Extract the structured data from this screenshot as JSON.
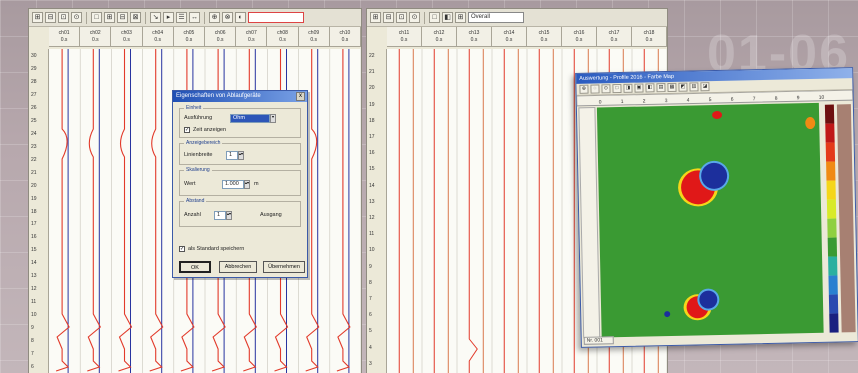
{
  "background": {
    "watermark": "01-06"
  },
  "left_window": {
    "toolbar": {
      "buttons": [
        "⊞",
        "⊟",
        "⊡",
        "⊙",
        "□",
        "⊞",
        "⊟",
        "⊠",
        "↘",
        "▸",
        "☰",
        "↔",
        "⊕",
        "⊗",
        "◐"
      ],
      "red_input": ""
    },
    "channels": [
      {
        "top": "ch01",
        "bottom": "0.s"
      },
      {
        "top": "ch02",
        "bottom": "0.s"
      },
      {
        "top": "ch03",
        "bottom": "0.s"
      },
      {
        "top": "ch04",
        "bottom": "0.s"
      },
      {
        "top": "ch05",
        "bottom": "0.s"
      },
      {
        "top": "ch06",
        "bottom": "0.s"
      },
      {
        "top": "ch07",
        "bottom": "0.s"
      },
      {
        "top": "ch08",
        "bottom": "0.s"
      },
      {
        "top": "ch09",
        "bottom": "0.s"
      },
      {
        "top": "ch10",
        "bottom": "0.s"
      }
    ],
    "axis_ticks": [
      "30",
      "29",
      "28",
      "27",
      "26",
      "25",
      "24",
      "23",
      "22",
      "21",
      "20",
      "19",
      "18",
      "17",
      "16",
      "15",
      "14",
      "13",
      "12",
      "11",
      "10",
      "9",
      "8",
      "7",
      "6"
    ]
  },
  "dialog": {
    "title": "Eigenschaften von Ablaufgeräte",
    "close": "x",
    "group1": {
      "label": "Einheit",
      "row_label": "Ausführung",
      "select_value": "Ohm",
      "checkbox_label": "Zeit anzeigen",
      "checked": true
    },
    "group2": {
      "label": "Anzeigebereich",
      "row_label": "Linienbreite",
      "value": "1"
    },
    "group3": {
      "label": "Skalierung",
      "row_label": "Wert",
      "value": "1.000",
      "unit": "m"
    },
    "group4": {
      "label": "Abstand",
      "row_label": "Anzahl",
      "value": "1",
      "extra": "Ausgang"
    },
    "bottom_checkbox": {
      "label": "als Standard speichern",
      "checked": true
    },
    "buttons": {
      "ok": "OK",
      "cancel": "Abbrechen",
      "apply": "Übernehmen"
    }
  },
  "right_window": {
    "toolbar": {
      "buttons": [
        "⊞",
        "⊟",
        "⊡",
        "⊙",
        "□",
        "◧",
        "⊞"
      ],
      "input": "Overall"
    },
    "channels": [
      {
        "top": "ch11",
        "bottom": "0.s"
      },
      {
        "top": "ch12",
        "bottom": "0.s"
      },
      {
        "top": "ch13",
        "bottom": "0.s"
      },
      {
        "top": "ch14",
        "bottom": "0.s"
      },
      {
        "top": "ch15",
        "bottom": "0.s"
      },
      {
        "top": "ch16",
        "bottom": "0.s"
      },
      {
        "top": "ch17",
        "bottom": "0.s"
      },
      {
        "top": "ch18",
        "bottom": "0.s"
      }
    ],
    "axis_ticks": [
      "22",
      "21",
      "20",
      "19",
      "18",
      "17",
      "16",
      "15",
      "14",
      "13",
      "12",
      "11",
      "10",
      "9",
      "8",
      "7",
      "6",
      "5",
      "4",
      "3"
    ]
  },
  "map_window": {
    "title": "Auswertung - Profile 2016 - Farbe Map",
    "toolbar_buttons": [
      "⊕",
      "◌",
      "⊙",
      "□",
      "◨",
      "▣",
      "◧",
      "▤",
      "▦",
      "◩",
      "▥",
      "◪"
    ],
    "status": "Nr. 001",
    "ruler_ticks": [
      "0",
      "1",
      "2",
      "3",
      "4",
      "5",
      "6",
      "7",
      "8",
      "9",
      "10"
    ],
    "colors": {
      "field": "#3a9a33",
      "positive": "#e01818",
      "negative": "#1c2f9c"
    }
  }
}
